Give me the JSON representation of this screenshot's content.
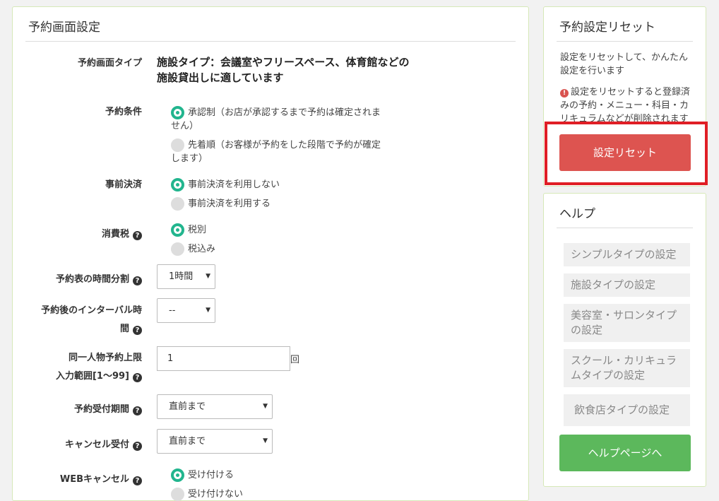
{
  "main": {
    "title": "予約画面設定",
    "type_label": "予約画面タイプ",
    "type_value_line1": "施設タイプ：会議室やフリースペース、体育館などの",
    "type_value_line2": "施設貸出しに適しています",
    "condition_label": "予約条件",
    "condition_options": [
      {
        "label": "承認制（お店が承認するまで予約は確定されません）",
        "selected": true
      },
      {
        "label": "先着順（お客様が予約をした段階で予約が確定します）",
        "selected": false
      }
    ],
    "prepay_label": "事前決済",
    "prepay_options": [
      {
        "label": "事前決済を利用しない",
        "selected": true
      },
      {
        "label": "事前決済を利用する",
        "selected": false
      }
    ],
    "tax_label": "消費税",
    "tax_options": [
      {
        "label": "税別",
        "selected": true
      },
      {
        "label": "税込み",
        "selected": false
      }
    ],
    "slot_label": "予約表の時間分割",
    "slot_value": "1時間",
    "interval_label_line1": "予約後のインターバル時",
    "interval_label_line2": "間",
    "interval_value": "--",
    "limit_label_line1": "同一人物予約上限",
    "limit_label_line2": "入力範囲[1～99]",
    "limit_value": "1",
    "limit_unit": "回",
    "period_label": "予約受付期間",
    "period_value": "直前まで",
    "cancel_label": "キャンセル受付",
    "cancel_value": "直前まで",
    "web_cancel_label": "WEBキャンセル",
    "web_cancel_options": [
      {
        "label": "受け付ける",
        "selected": true
      },
      {
        "label": "受け付けない",
        "selected": false
      }
    ]
  },
  "reset": {
    "title": "予約設定リセット",
    "description": "設定をリセットして、かんたん設定を行います",
    "warning": "設定をリセットすると登録済みの予約・メニュー・科目・カリキュラムなどが削除されます",
    "button_label": "設定リセット"
  },
  "help": {
    "title": "ヘルプ",
    "items": [
      "シンプルタイプの設定",
      "施設タイプの設定",
      "美容室・サロンタイプの設定",
      "スクール・カリキュラムタイプの設定",
      "飲食店タイプの設定"
    ],
    "button_label": "ヘルプページへ"
  },
  "colors": {
    "accent_green": "#22b58e",
    "reset_red": "#dd5450",
    "help_green": "#5cb85c",
    "highlight_red": "#e01e25"
  }
}
